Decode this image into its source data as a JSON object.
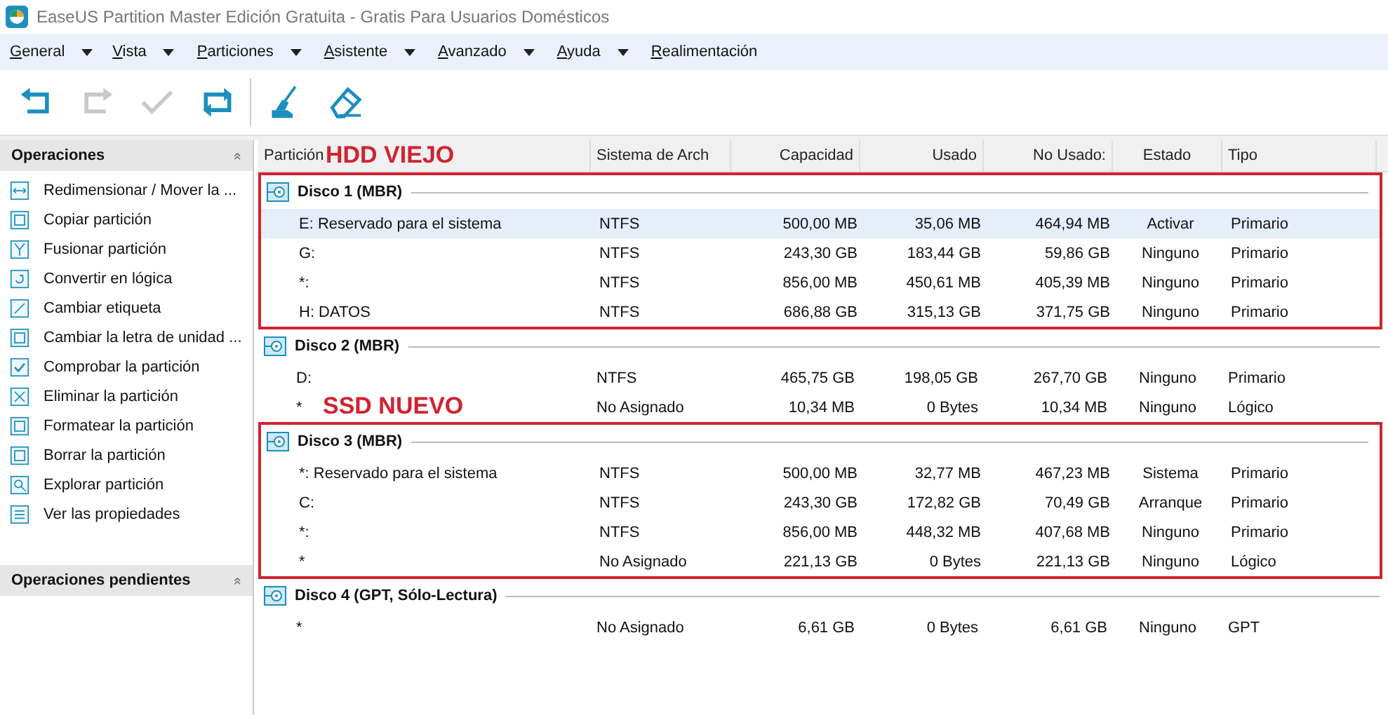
{
  "window": {
    "title": "EaseUS Partition Master Edición Gratuita - Gratis Para Usuarios Domésticos"
  },
  "menu": [
    {
      "label": "General",
      "dropdown": true
    },
    {
      "label": "Vista",
      "dropdown": true
    },
    {
      "label": "Particiones",
      "dropdown": true
    },
    {
      "label": "Asistente",
      "dropdown": true
    },
    {
      "label": "Avanzado",
      "dropdown": true
    },
    {
      "label": "Ayuda",
      "dropdown": true
    },
    {
      "label": "Realimentación",
      "dropdown": false
    }
  ],
  "toolbar": [
    {
      "disabled": false
    },
    {
      "disabled": true
    },
    {
      "disabled": true
    },
    {
      "disabled": false
    },
    {
      "disabled": false
    },
    {
      "disabled": false
    }
  ],
  "sidebar": {
    "sections": [
      {
        "title": "Operaciones",
        "collapse": "«",
        "items": [
          "Redimensionar / Mover la ...",
          "Copiar partición",
          "Fusionar partición",
          "Convertir en lógica",
          "Cambiar etiqueta",
          "Cambiar la letra de unidad ...",
          "Comprobar la partición",
          "Eliminar la partición",
          "Formatear la partición",
          "Borrar la partición",
          "Explorar partición",
          "Ver las propiedades"
        ]
      },
      {
        "title": "Operaciones pendientes",
        "collapse": "«"
      }
    ]
  },
  "table": {
    "columns": [
      "Partición",
      "Sistema de Arch",
      "Capacidad",
      "Usado",
      "No Usado:",
      "Estado",
      "Tipo"
    ],
    "disks": [
      {
        "name": "Disco 1 (MBR)",
        "annotation": "HDD VIEJO",
        "rows": [
          {
            "cells": [
              "E: Reservado para el sistema",
              "NTFS",
              "500,00 MB",
              "35,06 MB",
              "464,94 MB",
              "Activar",
              "Primario"
            ],
            "selected": true
          },
          {
            "cells": [
              "G:",
              "NTFS",
              "243,30 GB",
              "183,44 GB",
              "59,86 GB",
              "Ninguno",
              "Primario"
            ],
            "selected": false
          },
          {
            "cells": [
              "*:",
              "NTFS",
              "856,00 MB",
              "450,61 MB",
              "405,39 MB",
              "Ninguno",
              "Primario"
            ],
            "selected": false
          },
          {
            "cells": [
              "H: DATOS",
              "NTFS",
              "686,88 GB",
              "315,13 GB",
              "371,75 GB",
              "Ninguno",
              "Primario"
            ],
            "selected": false
          }
        ]
      },
      {
        "name": "Disco 2 (MBR)",
        "rows": [
          {
            "cells": [
              "D:",
              "NTFS",
              "465,75 GB",
              "198,05 GB",
              "267,70 GB",
              "Ninguno",
              "Primario"
            ],
            "selected": false
          },
          {
            "cells": [
              "*",
              "No Asignado",
              "10,34 MB",
              "0 Bytes",
              "10,34 MB",
              "Ninguno",
              "Lógico"
            ],
            "selected": false
          }
        ]
      },
      {
        "name": "Disco 3 (MBR)",
        "annotation": "SSD NUEVO",
        "rows": [
          {
            "cells": [
              "*: Reservado para el sistema",
              "NTFS",
              "500,00 MB",
              "32,77 MB",
              "467,23 MB",
              "Sistema",
              "Primario"
            ],
            "selected": false
          },
          {
            "cells": [
              "C:",
              "NTFS",
              "243,30 GB",
              "172,82 GB",
              "70,49 GB",
              "Arranque",
              "Primario"
            ],
            "selected": false
          },
          {
            "cells": [
              "*:",
              "NTFS",
              "856,00 MB",
              "448,32 MB",
              "407,68 MB",
              "Ninguno",
              "Primario"
            ],
            "selected": false
          },
          {
            "cells": [
              "*",
              "No Asignado",
              "221,13 GB",
              "0 Bytes",
              "221,13 GB",
              "Ninguno",
              "Lógico"
            ],
            "selected": false
          }
        ]
      },
      {
        "name": "Disco 4 (GPT, Sólo-Lectura)",
        "rows": [
          {
            "cells": [
              "*",
              "No Asignado",
              "6,61 GB",
              "0 Bytes",
              "6,61 GB",
              "Ninguno",
              "GPT"
            ],
            "selected": false
          }
        ]
      }
    ]
  }
}
